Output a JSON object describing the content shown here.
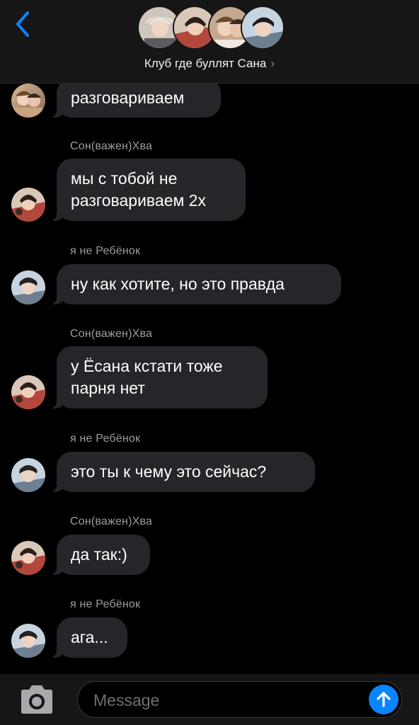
{
  "header": {
    "group_name": "Клуб где буллят Сана",
    "chevron": "›",
    "back_icon": "chevron-left-icon",
    "avatar_count": 4
  },
  "messages": [
    {
      "sender": "",
      "text": "разговариваем",
      "avatar": "person-b"
    },
    {
      "sender": "Сон(важен)Хва",
      "text": "мы с тобой не\nразговариваем 2х",
      "avatar": "person-a"
    },
    {
      "sender": "я не Ребёнок",
      "text": "ну как хотите, но это правда",
      "avatar": "person-c"
    },
    {
      "sender": "Сон(важен)Хва",
      "text": "у Ёсана кстати тоже\nпарня нет",
      "avatar": "person-a"
    },
    {
      "sender": "я не Ребёнок",
      "text": "это ты к чему это сейчас?",
      "avatar": "person-c"
    },
    {
      "sender": "Сон(важен)Хва",
      "text": "да так:)",
      "avatar": "person-a"
    },
    {
      "sender": "я не Ребёнок",
      "text": "ага...",
      "avatar": "person-c"
    }
  ],
  "composer": {
    "placeholder": "Message",
    "camera_icon": "camera-icon",
    "send_icon": "arrow-up-icon"
  },
  "colors": {
    "background": "#000000",
    "bar": "#161616",
    "bubble": "#26252a",
    "sender_text": "#9d9da2",
    "accent": "#0a84ff"
  }
}
